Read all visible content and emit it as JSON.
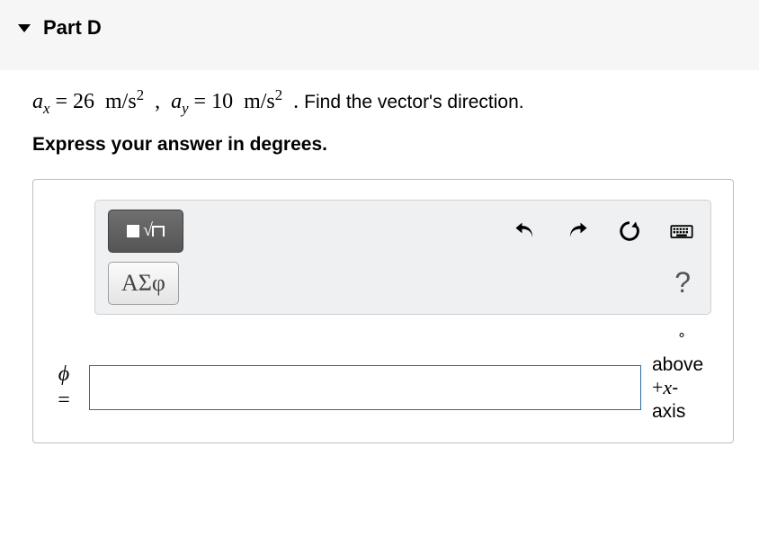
{
  "header": {
    "title": "Part D"
  },
  "problem": {
    "ax_var": "a",
    "ax_sub": "x",
    "eq": "=",
    "ax_val": "26",
    "unit_m_s2_1": "m/s",
    "sq": "2",
    "comma": ",",
    "ay_var": "a",
    "ay_sub": "y",
    "ay_val": "10",
    "unit_m_s2_2": "m/s",
    "period": ".",
    "tail": "Find the vector's direction."
  },
  "instruction": "Express your answer in degrees.",
  "toolbar": {
    "greek_label": "ΑΣφ",
    "help_label": "?"
  },
  "input": {
    "phi": "ϕ",
    "eq": "=",
    "value": ""
  },
  "units": {
    "deg": "∘",
    "above": "above",
    "plus": "+",
    "x": "x",
    "dash": "-",
    "axis": "axis"
  }
}
